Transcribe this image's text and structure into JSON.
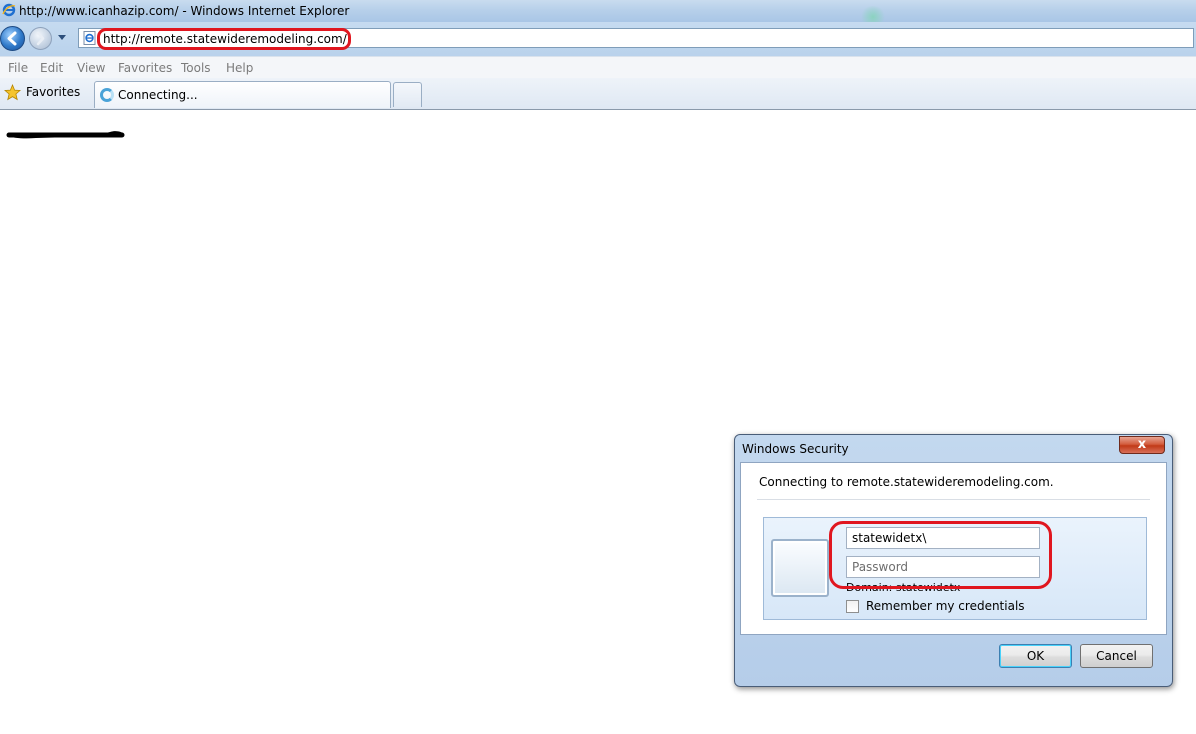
{
  "browser": {
    "window_title": "http://www.icanhazip.com/ - Windows Internet Explorer",
    "address": {
      "url": "http://remote.statewideremodeling.com/"
    },
    "menu": [
      "File",
      "Edit",
      "View",
      "Favorites",
      "Tools",
      "Help"
    ],
    "favorites_label": "Favorites",
    "tabs": [
      {
        "label": "Connecting...",
        "state": "loading"
      }
    ]
  },
  "dialog": {
    "title": "Windows Security",
    "close_symbol": "x",
    "message": "Connecting to remote.statewideremodeling.com.",
    "username_value": "statewidetx\\",
    "password_placeholder": "Password",
    "domain_text": "Domain: statewidetx",
    "remember_label": "Remember my credentials",
    "remember_checked": false,
    "ok_label": "OK",
    "cancel_label": "Cancel"
  },
  "annotations": {
    "highlight_color": "#e0161f"
  }
}
